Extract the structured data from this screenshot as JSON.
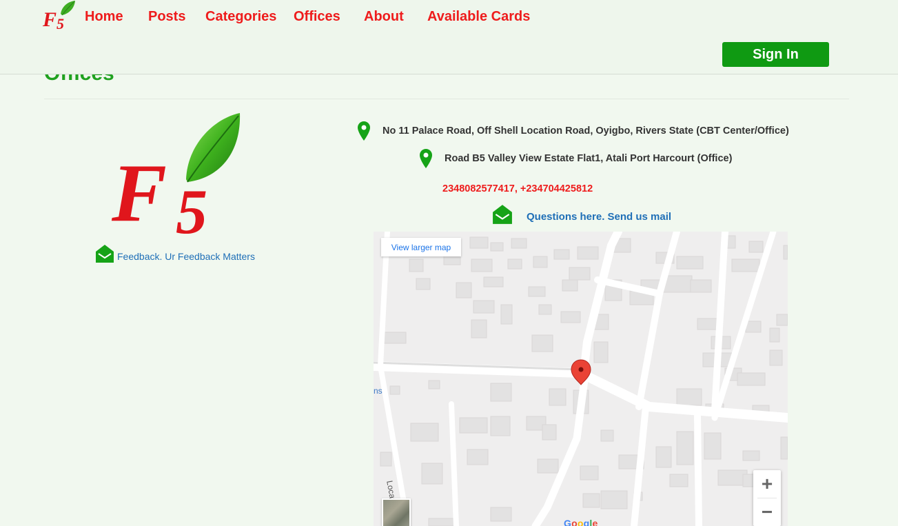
{
  "nav": {
    "links": [
      "Home",
      "Posts",
      "Categories",
      "Offices",
      "About",
      "Available Cards"
    ],
    "signin_label": "Sign In"
  },
  "page": {
    "title": "Offices"
  },
  "offices": {
    "address_1": "No 11 Palace Road, Off Shell Location Road, Oyigbo, Rivers State (CBT Center/Office)",
    "address_2": "Road B5 Valley View Estate Flat1, Atali Port Harcourt (Office)",
    "phones": "2348082577417, +234704425812",
    "mail_link": "Questions here. Send us mail"
  },
  "feedback": {
    "link": "Feedback. Ur Feedback Matters"
  },
  "map": {
    "view_larger": "View larger map",
    "zoom_in": "+",
    "zoom_out": "−",
    "street_label": "Location Road",
    "edge_label": "ns",
    "google_letters": [
      "G",
      "o",
      "o",
      "g",
      "l",
      "e"
    ]
  },
  "colors": {
    "brand_green": "#0f9a12",
    "nav_red": "#ee1c1c",
    "link_blue": "#1f6fb7",
    "pin_green": "#16a317",
    "marker_red": "#ea4335"
  }
}
